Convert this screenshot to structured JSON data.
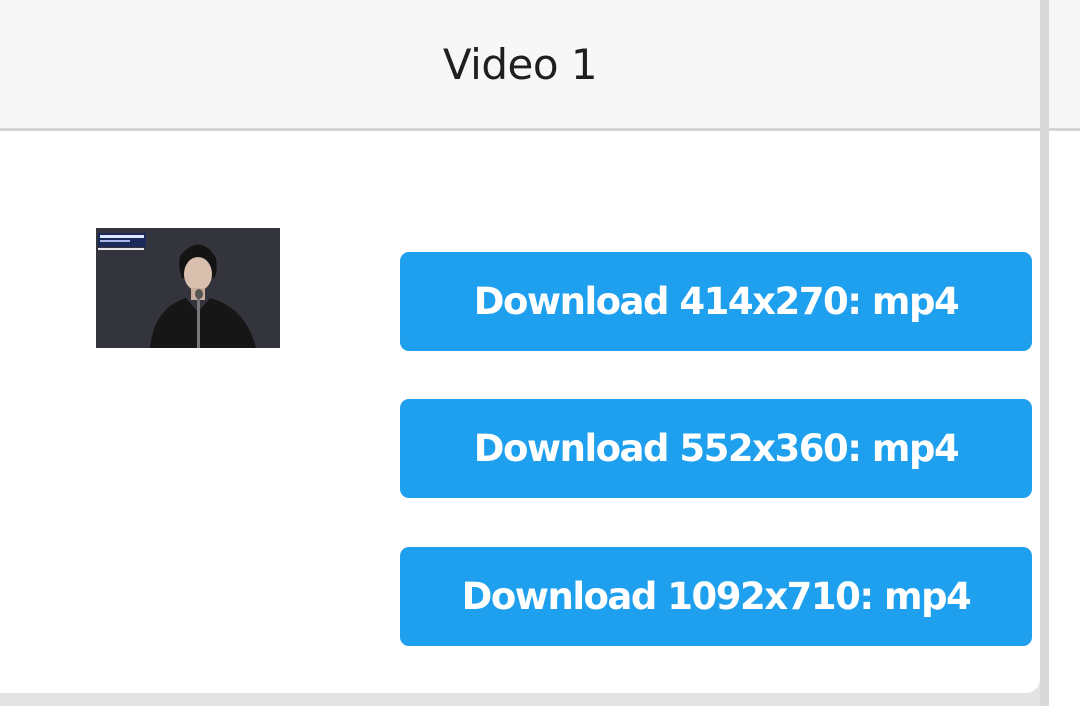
{
  "video": {
    "title": "Video 1",
    "thumbnail_alt": "video thumbnail"
  },
  "downloads": [
    {
      "label": "Download 414x270: mp4"
    },
    {
      "label": "Download 552x360: mp4"
    },
    {
      "label": "Download 1092x710: mp4"
    }
  ],
  "colors": {
    "button": "#1ea0ee",
    "header_bg": "#f7f7f7",
    "page_bg": "#ffffff"
  }
}
